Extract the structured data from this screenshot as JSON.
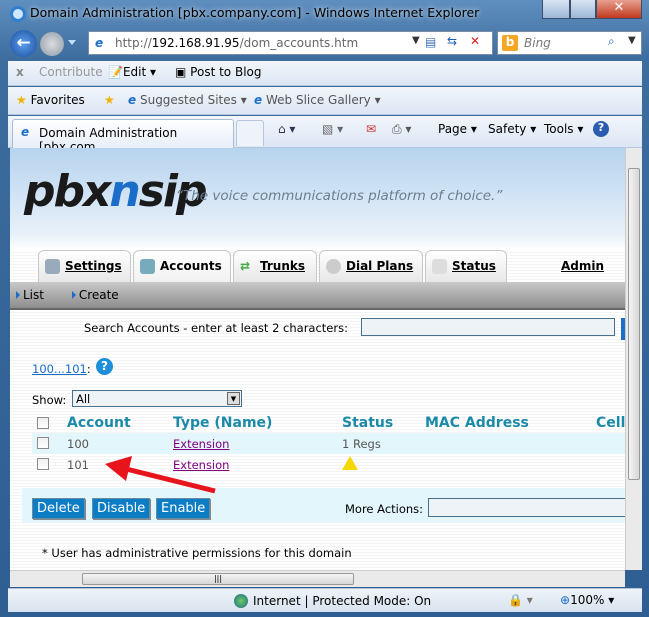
{
  "window": {
    "title": "Domain Administration [pbx.company.com] - Windows Internet Explorer"
  },
  "address": {
    "url_prefix": "http://",
    "url_host": "192.168.91.95",
    "url_path": "/dom_accounts.htm",
    "search_placeholder": "Bing"
  },
  "command_bar": {
    "contribute": "Contribute",
    "edit": "Edit",
    "post_to_blog": "Post to Blog"
  },
  "favorites_bar": {
    "favorites": "Favorites",
    "suggested_sites": "Suggested Sites",
    "web_slice_gallery": "Web Slice Gallery"
  },
  "tab": {
    "label": "Domain Administration [pbx.com..."
  },
  "toolbar": {
    "page": "Page",
    "safety": "Safety",
    "tools": "Tools"
  },
  "page": {
    "logo_a": "pbx",
    "logo_n": "n",
    "logo_b": "sip",
    "tagline": "“The voice communications platform of choice.”",
    "tabs": [
      {
        "label": "Settings"
      },
      {
        "label": "Accounts"
      },
      {
        "label": "Trunks"
      },
      {
        "label": "Dial Plans"
      },
      {
        "label": "Status"
      }
    ],
    "admin": "Admin",
    "subnav": [
      "List",
      "Create"
    ],
    "search_label": "Search Accounts - enter at least 2 characters:",
    "range_link": "100...101",
    "show_label": "Show:",
    "show_value": "All",
    "columns": [
      "Account",
      "Type (Name)",
      "Status",
      "MAC Address",
      "Cell"
    ],
    "rows": [
      {
        "account": "100",
        "type": "Extension",
        "status": "1 Regs"
      },
      {
        "account": "101",
        "type": "Extension",
        "status": "warning-icon"
      }
    ],
    "buttons": {
      "delete": "Delete",
      "disable": "Disable",
      "enable": "Enable"
    },
    "more_actions": "More Actions:",
    "footnote": "* User has administrative permissions for this domain"
  },
  "statusbar": {
    "zone": "Internet | Protected Mode: On",
    "zoom": "100%"
  },
  "colors": {
    "accent": "#0c7cc4",
    "header_text": "#1b8aa8",
    "annotation_arrow": "#e8141b"
  }
}
